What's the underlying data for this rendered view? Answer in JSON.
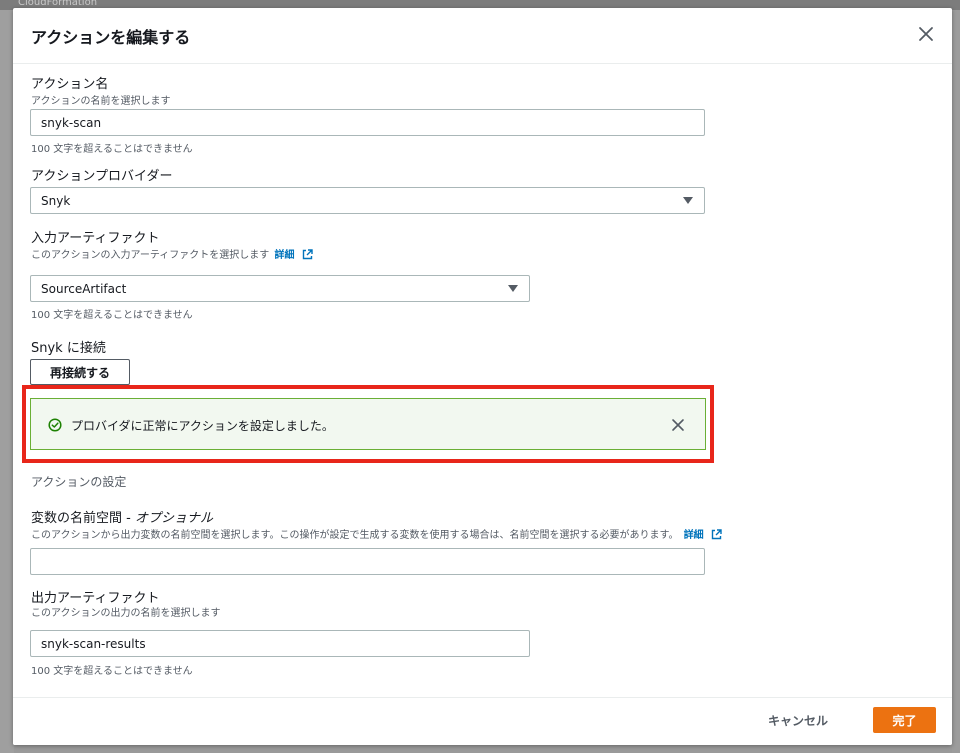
{
  "background": {
    "service_tab": "CloudFormation"
  },
  "modal": {
    "title": "アクションを編集する"
  },
  "action_name": {
    "label": "アクション名",
    "description": "アクションの名前を選択します",
    "value": "snyk-scan",
    "constraint": "100 文字を超えることはできません"
  },
  "action_provider": {
    "label": "アクションプロバイダー",
    "selected": "Snyk"
  },
  "input_artifacts": {
    "label": "入力アーティファクト",
    "description": "このアクションの入力アーティファクトを選択します",
    "info_link": "詳細",
    "selected": "SourceArtifact",
    "constraint": "100 文字を超えることはできません"
  },
  "snyk_connect": {
    "label": "Snyk に接続",
    "reconnect_label": "再接続する"
  },
  "alert": {
    "message": "プロバイダに正常にアクションを設定しました。",
    "color": "#6aaf35"
  },
  "action_settings": {
    "heading": "アクションの設定"
  },
  "variable_namespace": {
    "label": "変数の名前空間 - ",
    "label_optional": "オプショナル",
    "description": "このアクションから出力変数の名前空間を選択します。この操作が設定で生成する変数を使用する場合は、名前空間を選択する必要があります。",
    "info_link": "詳細",
    "value": ""
  },
  "output_artifacts": {
    "label": "出力アーティファクト",
    "description": "このアクションの出力の名前を選択します",
    "value": "snyk-scan-results",
    "constraint": "100 文字を超えることはできません"
  },
  "footer": {
    "cancel_label": "キャンセル",
    "done_label": "完了"
  },
  "colors": {
    "primary_button": "#ec7211",
    "link": "#0073bb",
    "highlight": "#e8261a"
  }
}
